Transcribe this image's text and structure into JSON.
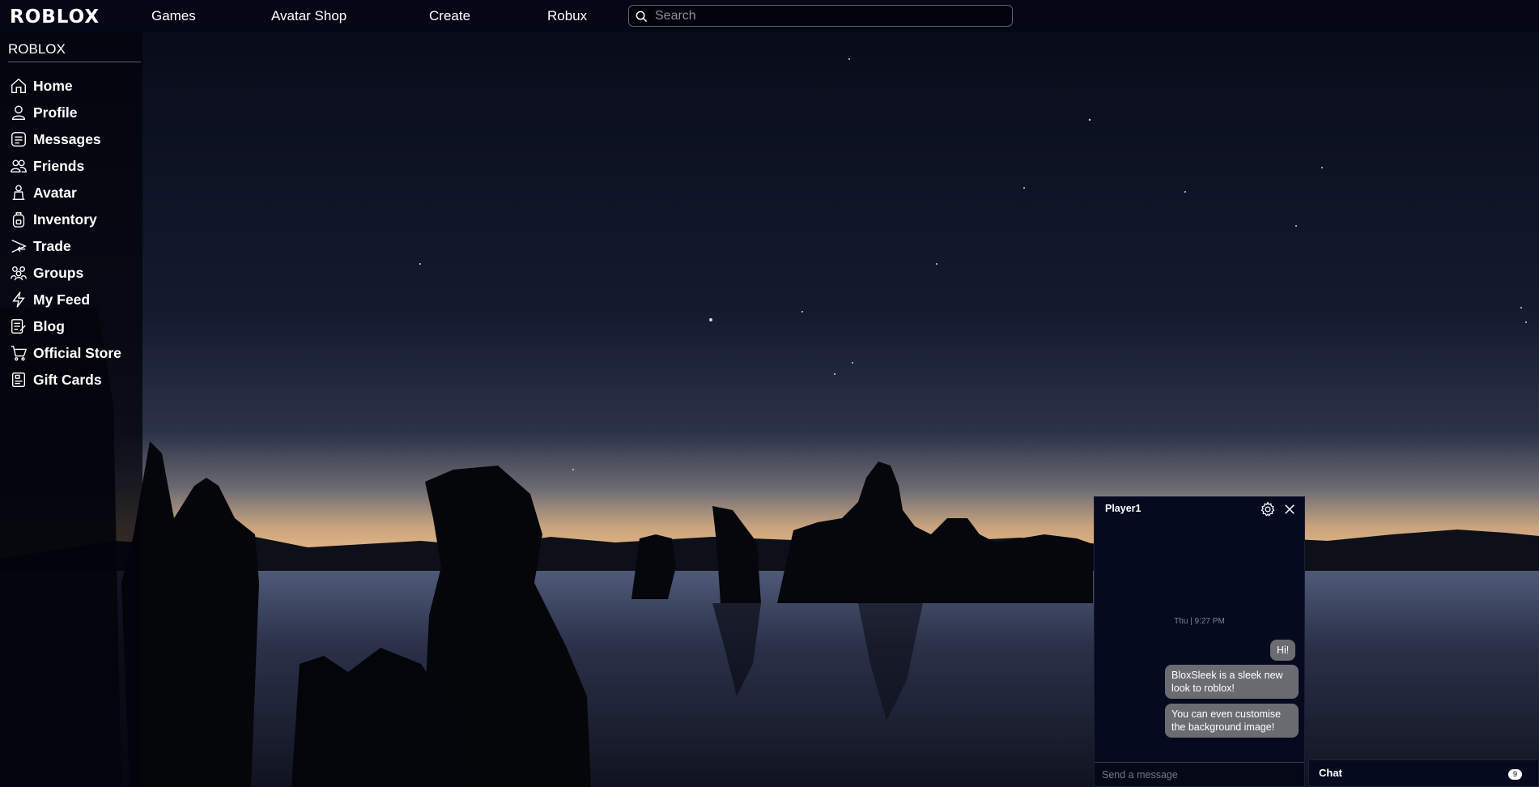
{
  "topnav": {
    "logo": "ROBLOX",
    "links": [
      "Games",
      "Avatar Shop",
      "Create",
      "Robux"
    ],
    "search_placeholder": "Search"
  },
  "sidebar": {
    "brand": "ROBLOX",
    "items": [
      {
        "label": "Home",
        "icon": "home-icon"
      },
      {
        "label": "Profile",
        "icon": "profile-icon"
      },
      {
        "label": "Messages",
        "icon": "messages-icon"
      },
      {
        "label": "Friends",
        "icon": "friends-icon"
      },
      {
        "label": "Avatar",
        "icon": "avatar-icon"
      },
      {
        "label": "Inventory",
        "icon": "inventory-icon"
      },
      {
        "label": "Trade",
        "icon": "trade-icon"
      },
      {
        "label": "Groups",
        "icon": "groups-icon"
      },
      {
        "label": "My Feed",
        "icon": "feed-icon"
      },
      {
        "label": "Blog",
        "icon": "blog-icon"
      },
      {
        "label": "Official Store",
        "icon": "store-cart-icon"
      },
      {
        "label": "Gift Cards",
        "icon": "gift-card-icon"
      }
    ]
  },
  "chat_window": {
    "title": "Player1",
    "timestamp": "Thu | 9:27 PM",
    "messages": [
      "Hi!",
      "BloxSleek is a sleek new look to roblox!",
      "You can even customise the background image!"
    ],
    "input_placeholder": "Send a message"
  },
  "chat_dock": {
    "label": "Chat",
    "badge": "9"
  }
}
